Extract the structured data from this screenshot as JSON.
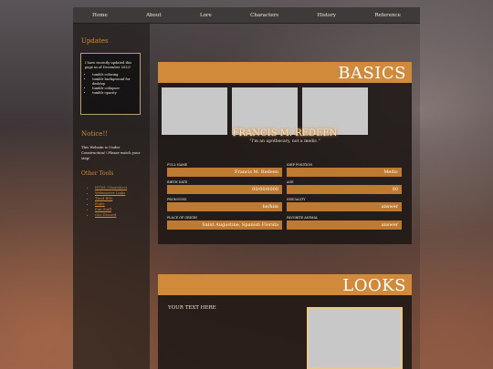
{
  "nav": {
    "items": [
      "Home",
      "About",
      "Lore",
      "Characters",
      "History",
      "Reference"
    ]
  },
  "sidebar": {
    "updates_heading": "Updates",
    "update_note": "I have recently updated this page as of December 2022!",
    "update_items": [
      "tumblr coloring",
      "tumblr background for desktop",
      "tumblr collapser",
      "tumblr opacity"
    ],
    "notice_heading": "Notice!!",
    "notice_text": "This Website is Under Construction!! Please watch your step!",
    "tools_heading": "Other Tools",
    "tools_links": [
      "HTML Cheatsheet",
      "Webmaster Links",
      "Tired BGs",
      "Fonts",
      "Fun Stuff",
      "Our Discord"
    ]
  },
  "basics": {
    "title": "BASICS",
    "name": "FRANCIS M. REDEEN",
    "quote": "\"I'm an apothecary, not a medic.\"",
    "fields": [
      {
        "label": "FULL NAME",
        "value": "Francis M. Redeen"
      },
      {
        "label": "SHIP POSITION",
        "value": "Medic"
      },
      {
        "label": "BIRTH DATE",
        "value": "00/00/0000"
      },
      {
        "label": "AGE",
        "value": "00"
      },
      {
        "label": "PRONOUNS",
        "value": "he/him"
      },
      {
        "label": "SEXUALITY",
        "value": "answer"
      },
      {
        "label": "PLACE OF ORIGIN",
        "value": "Saint Augustine, Spanish Florida"
      },
      {
        "label": "FAVORITE ANIMAL",
        "value": "answer"
      }
    ]
  },
  "looks": {
    "title": "LOOKS",
    "text": "YOUR TEXT HERE"
  },
  "colors": {
    "accent": "#d08a3a",
    "field_bg": "#bd7a30",
    "nav_bg": "#3e3a3a"
  }
}
